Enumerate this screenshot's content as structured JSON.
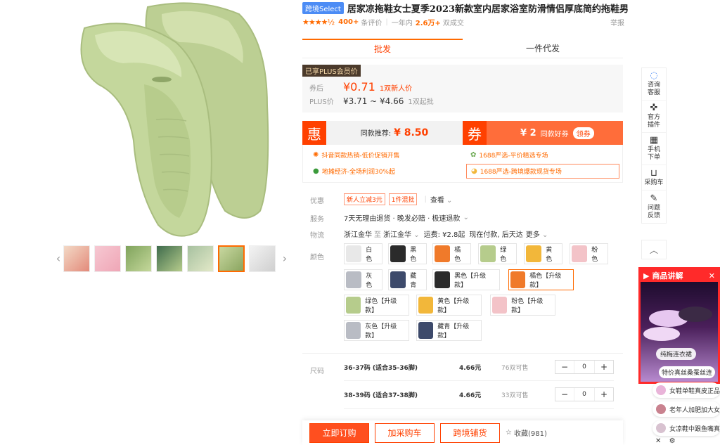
{
  "header": {
    "badge": "跨境Select",
    "title": "居家凉拖鞋女士夏季2023新款室内居家浴室防滑情侣厚底简约拖鞋男"
  },
  "rating": {
    "count": "400+",
    "count_label": "条评价",
    "period_label": "一年内",
    "sold": "2.6万+",
    "sold_label": "双成交",
    "report": "举报"
  },
  "tabs": [
    {
      "label": "批发"
    },
    {
      "label": "一件代发"
    }
  ],
  "price": {
    "plus_tag": "已享PLUS会员价",
    "after_coupon_label": "券后",
    "after_coupon_price": "¥0.71",
    "after_coupon_note": "1双新人价",
    "plus_label": "PLUS价",
    "plus_range": "¥3.71 ~ ¥4.66",
    "plus_moq": "1双起批"
  },
  "promo": {
    "hui": "惠",
    "recommend_label": "同款推荐:",
    "recommend_price": "¥ 8.50",
    "quan": "券",
    "coupon_amount": "¥ 2",
    "coupon_text": "同款好券",
    "coupon_btn": "领券",
    "items": [
      "抖音同款热销-低价促销开售",
      "1688严选-平价精选专场",
      "地摊经济-全场利润30%起",
      "1688严选-跨境爆款现货专场"
    ]
  },
  "attrs": {
    "offer_label": "优惠",
    "offer_tags": [
      "新人立减3元",
      "1件混批"
    ],
    "offer_more": "查看",
    "service_label": "服务",
    "service_text": "7天无理由退货 · 晚发必赔 · 极速退款",
    "logistics_label": "物流",
    "logistics_from": "浙江金华",
    "logistics_to_word": "至",
    "logistics_to": "浙江金华",
    "logistics_fee": "运费: ¥2.8起",
    "logistics_time": "现在付款, 后天达",
    "logistics_more": "更多",
    "color_label": "颜色",
    "size_label": "尺码"
  },
  "colors": [
    {
      "label": "白色",
      "color": "#e8e8e8"
    },
    {
      "label": "黑色",
      "color": "#2b2b2b"
    },
    {
      "label": "橘色",
      "color": "#f07a2a"
    },
    {
      "label": "绿色",
      "color": "#b6cc8c"
    },
    {
      "label": "黄色",
      "color": "#f2b73a"
    },
    {
      "label": "粉色",
      "color": "#f3c3c8"
    },
    {
      "label": "灰色",
      "color": "#b9bcc4"
    },
    {
      "label": "藏青",
      "color": "#3d4a6b"
    },
    {
      "label": "黑色【升级款】",
      "color": "#2b2b2b"
    },
    {
      "label": "橘色【升级款】",
      "color": "#f07a2a"
    },
    {
      "label": "绿色【升级款】",
      "color": "#b6cc8c"
    },
    {
      "label": "黄色【升级款】",
      "color": "#f2b73a"
    },
    {
      "label": "粉色【升级款】",
      "color": "#f3c3c8"
    },
    {
      "label": "灰色【升级款】",
      "color": "#b9bcc4"
    },
    {
      "label": "藏青【升级款】",
      "color": "#3d4a6b"
    }
  ],
  "sizes": [
    {
      "name": "36-37码 (适合35-36脚)",
      "price": "4.66元",
      "stock": "76双可售",
      "qty": "0"
    },
    {
      "name": "38-39码 (适合37-38脚)",
      "price": "4.66元",
      "stock": "33双可售",
      "qty": "0"
    }
  ],
  "bottom": {
    "buy": "立即订购",
    "cart": "加采购车",
    "cross": "跨境铺货",
    "fav": "收藏(981)"
  },
  "sidebar": [
    {
      "label1": "咨询",
      "label2": "客服",
      "icon": "chat-icon"
    },
    {
      "label1": "官方",
      "label2": "插件",
      "icon": "puzzle-icon"
    },
    {
      "label1": "手机",
      "label2": "下单",
      "icon": "qrcode-icon"
    },
    {
      "label1": "",
      "label2": "采购车",
      "icon": "cart-icon"
    },
    {
      "label1": "问题",
      "label2": "反馈",
      "icon": "feedback-icon"
    }
  ],
  "video": {
    "title": "商品讲解",
    "chip": "纯梅连衣裙",
    "chip2": "特价真丝桑蚕丝连"
  },
  "live_items": [
    "女鞋单鞋真皮正品",
    "老年人加肥加大女",
    "女凉鞋中跟鱼嘴真"
  ],
  "colors_theme": {
    "accent": "#ff6a00",
    "price": "#ff4000"
  }
}
